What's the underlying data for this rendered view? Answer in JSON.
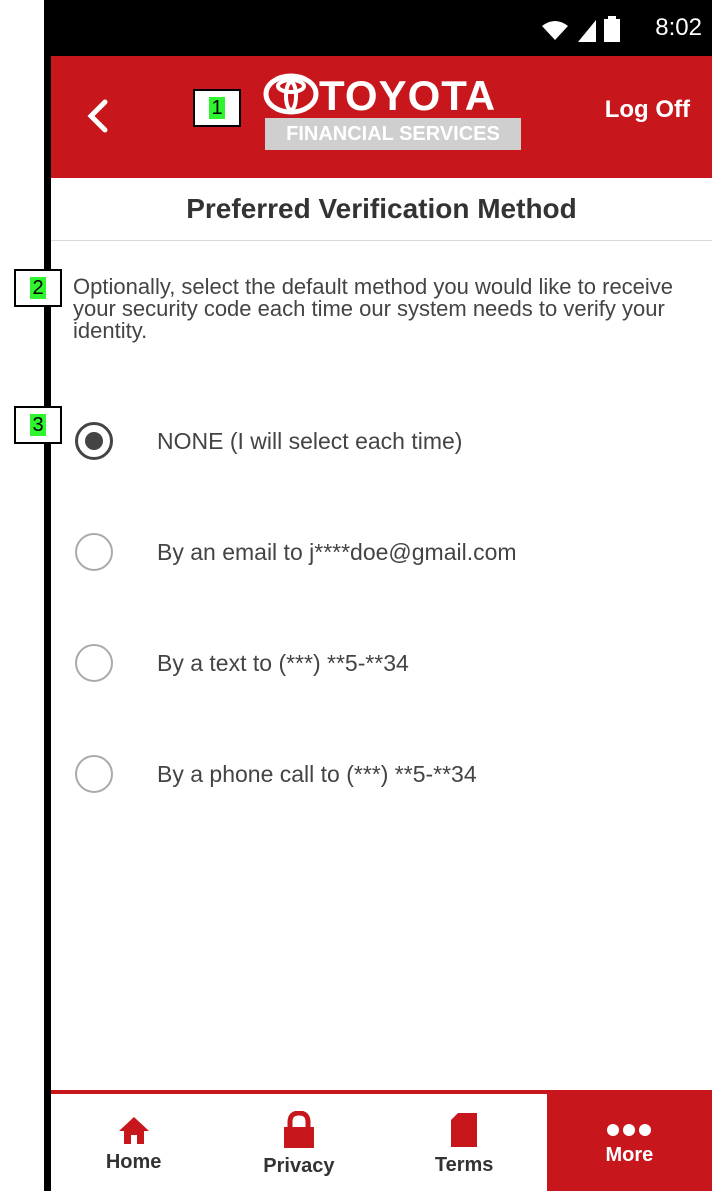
{
  "annotations": [
    "1",
    "2",
    "3"
  ],
  "status_bar": {
    "time": "8:02"
  },
  "header": {
    "brand_name": "TOYOTA",
    "brand_sub": "FINANCIAL SERVICES",
    "logoff_label": "Log Off"
  },
  "page": {
    "title": "Preferred Verification Method",
    "description": "Optionally, select the default method you would like to receive your security code each time our system needs to verify your identity."
  },
  "options": [
    {
      "label": "NONE (I will select each time)",
      "checked": true
    },
    {
      "label": "By an email to j****doe@gmail.com",
      "checked": false
    },
    {
      "label": "By a text to (***) **5-**34",
      "checked": false
    },
    {
      "label": "By a phone call to (***) **5-**34",
      "checked": false
    }
  ],
  "bottom_nav": [
    {
      "label": "Home",
      "icon": "home-icon"
    },
    {
      "label": "Privacy",
      "icon": "lock-icon"
    },
    {
      "label": "Terms",
      "icon": "document-icon"
    },
    {
      "label": "More",
      "icon": "more-icon",
      "active": true
    }
  ],
  "colors": {
    "accent": "#c8161d",
    "logo_band": "#cfcfcf"
  }
}
